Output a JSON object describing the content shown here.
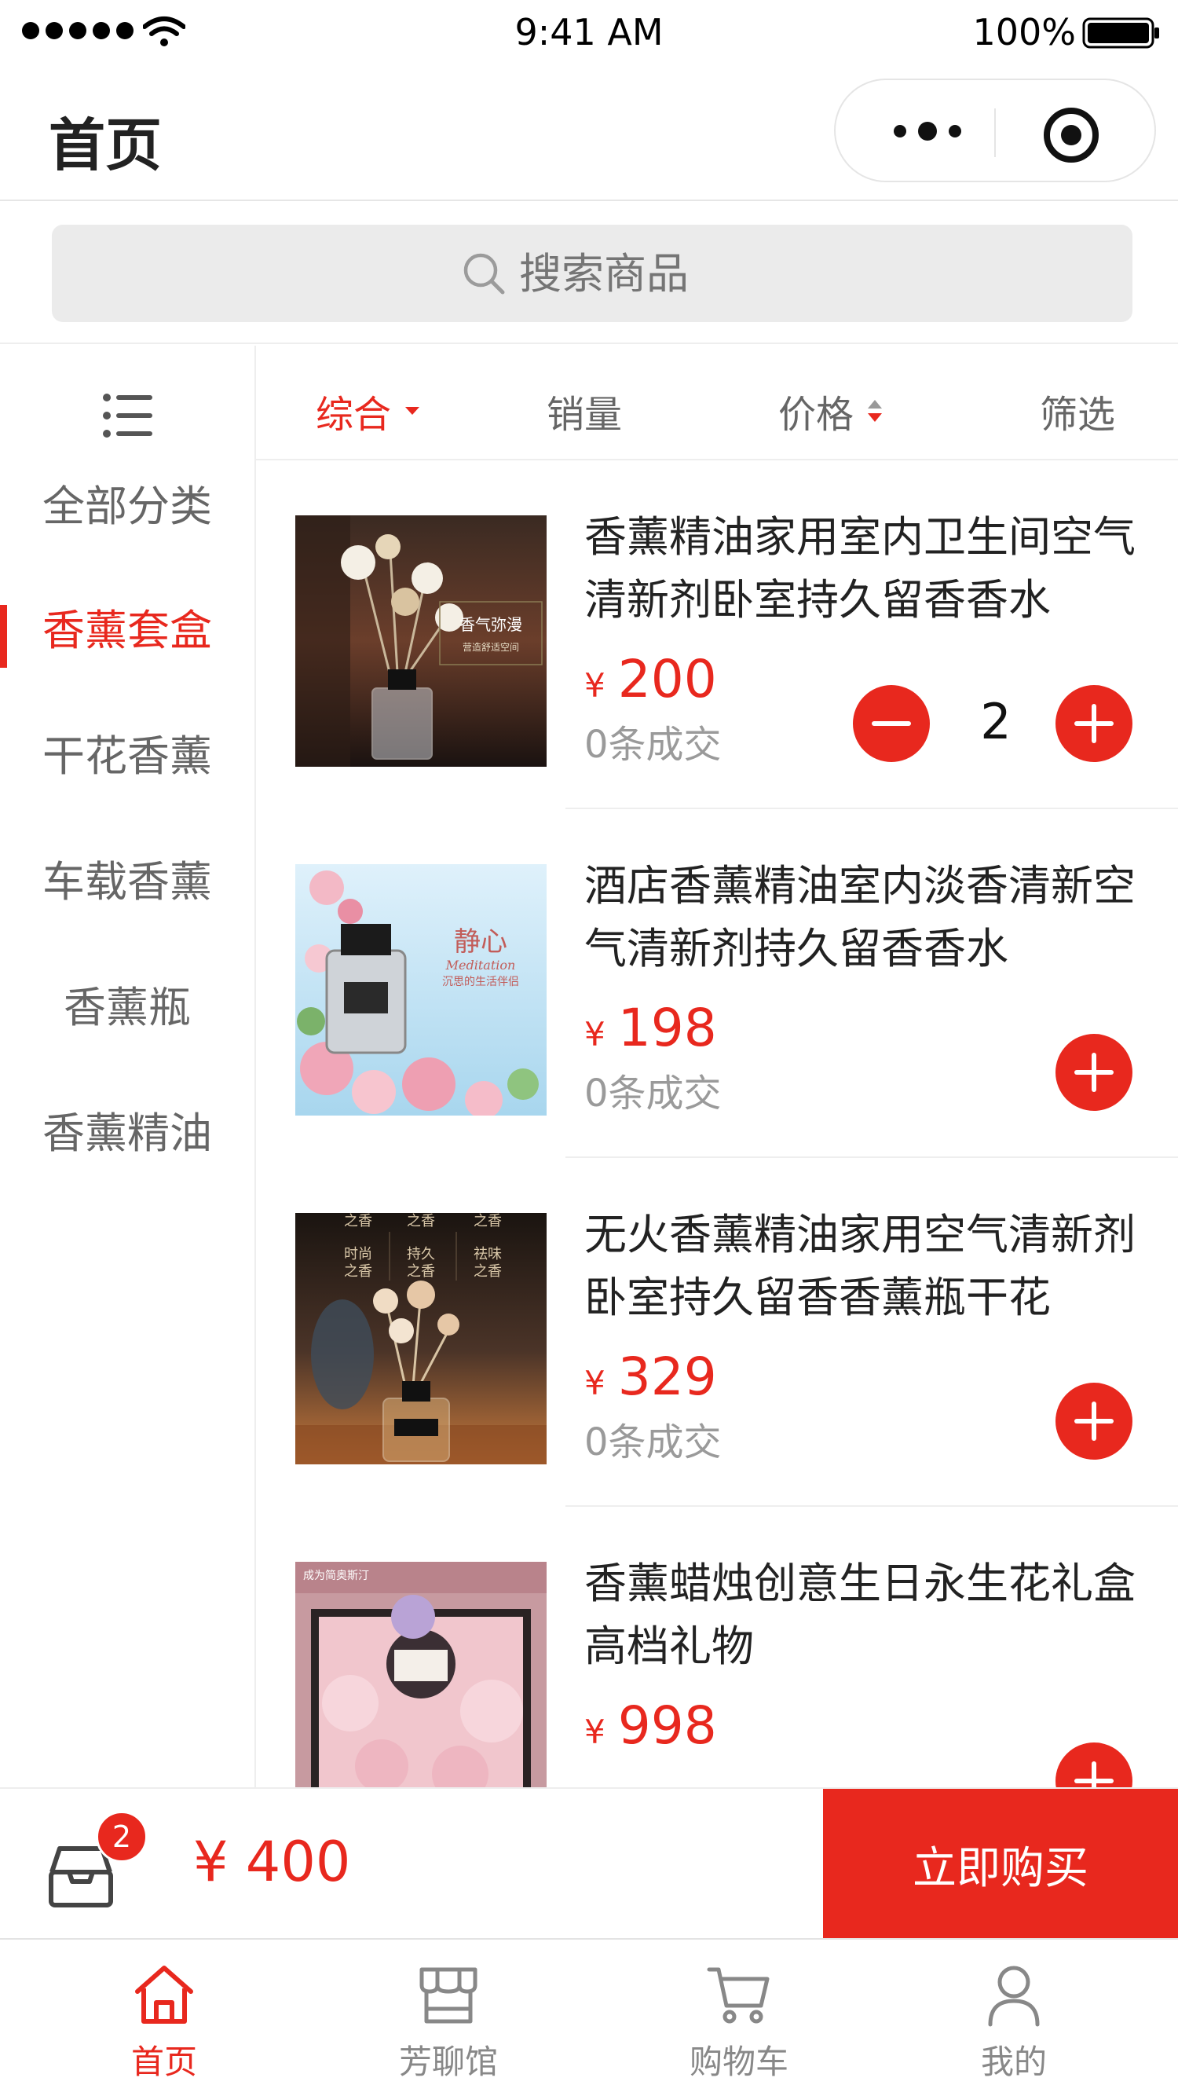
{
  "status_bar": {
    "time": "9:41 AM",
    "battery": "100%"
  },
  "nav": {
    "title": "首页"
  },
  "search": {
    "placeholder": "搜索商品"
  },
  "sidebar": {
    "categories": [
      {
        "label": "全部分类",
        "active": false
      },
      {
        "label": "香薰套盒",
        "active": true
      },
      {
        "label": "干花香薰",
        "active": false
      },
      {
        "label": "车载香薰",
        "active": false
      },
      {
        "label": "香薰瓶",
        "active": false
      },
      {
        "label": "香薰精油",
        "active": false
      }
    ]
  },
  "sort": {
    "items": [
      {
        "label": "综合",
        "active": true
      },
      {
        "label": "销量",
        "active": false
      },
      {
        "label": "价格",
        "active": false
      },
      {
        "label": "筛选",
        "active": false
      }
    ]
  },
  "products": [
    {
      "name": "香薰精油家用室内卫生间空气清新剂卧室持久留香香水",
      "currency": "¥",
      "price": "200",
      "sold": "0条成交",
      "quantity": "2",
      "image_text": [
        "香气弥漫",
        "营造舒适空间"
      ]
    },
    {
      "name": "酒店香薰精油室内淡香清新空气清新剂持久留香香水",
      "currency": "¥",
      "price": "198",
      "sold": "0条成交",
      "image_text": [
        "静心",
        "Meditation",
        "沉思的生活伴侣"
      ]
    },
    {
      "name": "无火香薰精油家用空气清新剂卧室持久留香香薰瓶干花",
      "currency": "¥",
      "price": "329",
      "sold": "0条成交",
      "image_text": [
        "之香",
        "之香",
        "之香",
        "时尚",
        "持久",
        "祛味",
        "之香",
        "之香",
        "之香"
      ]
    },
    {
      "name": "香薰蜡烛创意生日永生花礼盒高档礼物",
      "currency": "¥",
      "price": "998",
      "image_text": [
        "成为简奥斯汀"
      ]
    }
  ],
  "cart": {
    "count": "2",
    "total": "¥ 400",
    "buy_label": "立即购买"
  },
  "tabs": [
    {
      "label": "首页",
      "icon": "home-icon",
      "active": true
    },
    {
      "label": "芳聊馆",
      "icon": "store-icon",
      "active": false
    },
    {
      "label": "购物车",
      "icon": "cart-icon",
      "active": false
    },
    {
      "label": "我的",
      "icon": "user-icon",
      "active": false
    }
  ],
  "colors": {
    "accent": "#e8281e",
    "text": "#222222",
    "muted": "#9a9a9a"
  }
}
